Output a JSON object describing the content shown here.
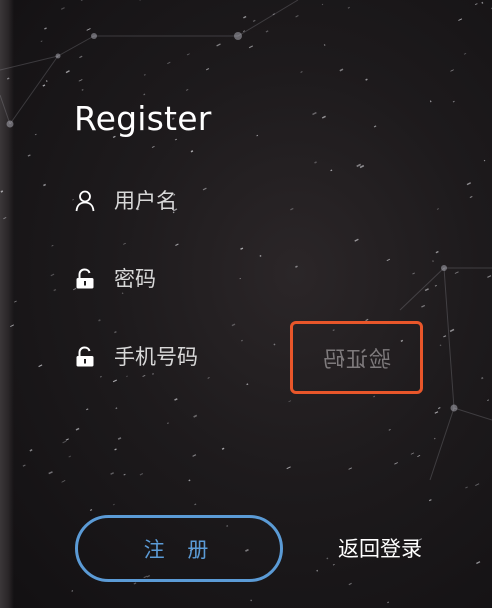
{
  "form": {
    "title": "Register",
    "username": {
      "placeholder": "用户名",
      "value": "",
      "icon": "user-icon"
    },
    "password": {
      "placeholder": "密码",
      "value": "",
      "icon": "lock-icon"
    },
    "phone": {
      "placeholder": "手机号码",
      "value": "",
      "icon": "lock-icon"
    },
    "verification_code": {
      "label": "验证码"
    },
    "register_button": "注 册",
    "back_to_login": "返回登录"
  },
  "colors": {
    "accent": "#5b9bd6",
    "highlight_border": "#e8562a",
    "text": "#ffffff"
  }
}
